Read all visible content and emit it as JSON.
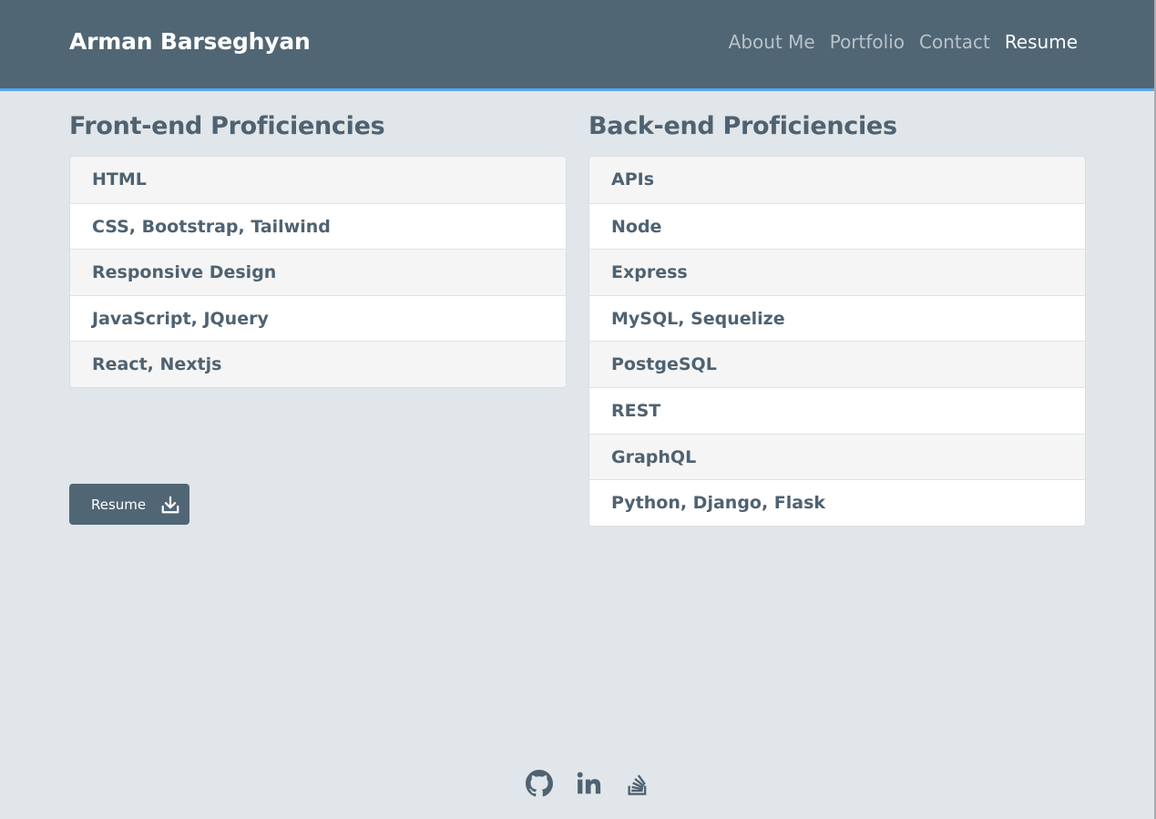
{
  "header": {
    "brand": "Arman Barseghyan",
    "nav": [
      {
        "label": "About Me",
        "active": false
      },
      {
        "label": "Portfolio",
        "active": false
      },
      {
        "label": "Contact",
        "active": false
      },
      {
        "label": "Resume",
        "active": true
      }
    ]
  },
  "frontend": {
    "title": "Front-end Proficiencies",
    "items": [
      "HTML",
      "CSS, Bootstrap, Tailwind",
      "Responsive Design",
      "JavaScript, JQuery",
      "React, Nextjs"
    ]
  },
  "backend": {
    "title": "Back-end Proficiencies",
    "items": [
      "APIs",
      "Node",
      "Express",
      "MySQL, Sequelize",
      "PostgeSQL",
      "REST",
      "GraphQL",
      "Python, Django, Flask"
    ]
  },
  "resume_button": {
    "label": "Resume",
    "icon": "download-icon"
  },
  "footer": {
    "icons": [
      "github-icon",
      "linkedin-icon",
      "stackoverflow-icon"
    ]
  },
  "colors": {
    "header_bg": "#516674",
    "accent_line": "#58a8e8",
    "page_bg": "#e0e6e9",
    "text": "#4f6271"
  }
}
